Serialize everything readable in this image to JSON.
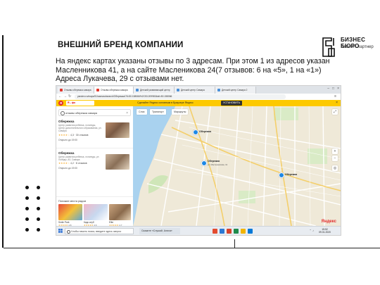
{
  "slide": {
    "title": "ВНЕШНИЙ БРЕНД КОМПАНИИ",
    "text": "На яндекс картах указаны отзывы по 3 адресам. При этом 1 из адресов указан Масленникова 41, а на сайте Масленикова 24(7 отзывов: 6 на «5», 1 на «1») Адреса Лукачева, 29 с отзывами нет."
  },
  "brand": {
    "name": "БИЗНЕС БЮРО",
    "tagline": "Ваш HR партнер"
  },
  "screenshot": {
    "tabs": [
      {
        "label": "Отзывы обережка самара"
      },
      {
        "label": "Отзывы обережка самара"
      },
      {
        "label": "Детский развивающий центр"
      },
      {
        "label": "Детский центр Самара"
      },
      {
        "label": "Детский центр Самара 2"
      }
    ],
    "url": "yandex.ru/maps/51/samara/search/Обережка/?ll=50.158066%2C53.209983&sll=50.158066",
    "yandex_bar": {
      "search_text": "Я ⎯ фо",
      "banner": "Сделайте Яндекс основным в Браузере Яндекс",
      "install_button": "УСТАНОВИТЬ"
    },
    "sidebar": {
      "search_value": "отзывы обережка самара",
      "orgs": [
        {
          "name": "Обережка",
          "description": "Центр развития ребенка, логопеды, Центр дополнительного образования, ул. Самара",
          "rating": "4,3",
          "reviews": "30 отзывов",
          "hours": "Открыто до 19:00"
        },
        {
          "name": "Обережка",
          "description": "Центр развития ребенка, логопеды, ул. Победы, 83, Самара",
          "rating": "4,2",
          "reviews": "8 отзывов",
          "hours": "Открыто до 19:00"
        }
      ],
      "similar_title": "Похожие места рядом",
      "similar": [
        {
          "label": "Smile Park",
          "rating": "4,8"
        },
        {
          "label": "Кидс клуб",
          "rating": "4,6"
        },
        {
          "label": "Elite",
          "rating": "4,7"
        }
      ]
    },
    "map": {
      "buttons": [
        "Слои",
        "Транспорт",
        "Маршруты"
      ],
      "pins": [
        {
          "label": "Обережка",
          "sub": ""
        },
        {
          "label": "Обережка",
          "sub": "ул. Масленникова, 41"
        },
        {
          "label": "Обережка",
          "sub": ""
        }
      ],
      "logo": "Яндекс"
    },
    "taskbar": {
      "search_placeholder": "Чтобы начать поиск, введите здесь запрос",
      "notification": "Скажите «Слушай, Алиса»",
      "time": "15:52",
      "date": "09.01.2020"
    }
  },
  "colors": {
    "yandex_yellow": "#fdc900",
    "yandex_red": "#e22c2c",
    "pin_blue": "#1e88e5"
  }
}
